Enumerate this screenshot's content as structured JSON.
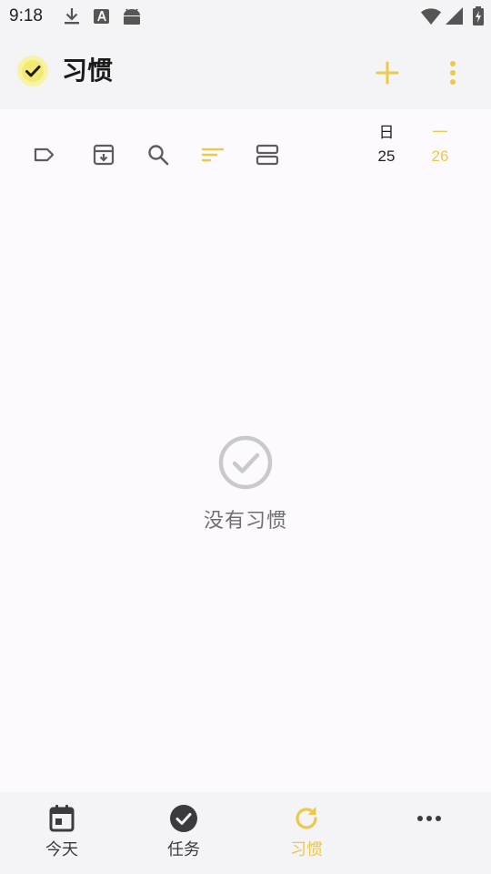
{
  "status_bar": {
    "time": "9:18"
  },
  "app_bar": {
    "title": "习惯",
    "icons": {
      "logo": "check-circle-icon",
      "add": "plus-icon",
      "more": "more-vert-icon"
    }
  },
  "toolbar": {
    "icons": [
      "label-icon",
      "archive-icon",
      "search-icon",
      "sort-icon",
      "view-agenda-icon"
    ],
    "days": [
      {
        "name": "日",
        "date": "25"
      },
      {
        "name": "一",
        "date": "26"
      }
    ]
  },
  "empty_state": {
    "text": "没有习惯",
    "icon": "check-circle-outline-icon"
  },
  "bottom_nav": {
    "items": [
      {
        "label": "今天",
        "icon": "calendar-icon"
      },
      {
        "label": "任务",
        "icon": "check-circle-icon"
      },
      {
        "label": "习惯",
        "icon": "refresh-icon"
      },
      {
        "label": "",
        "icon": "more-horiz-icon"
      }
    ],
    "active_index": 2
  },
  "colors": {
    "accent": "#ecc94b",
    "icon_gray": "#5c5c60",
    "background": "#fcfaff",
    "bar_background": "#f4f3f5"
  }
}
